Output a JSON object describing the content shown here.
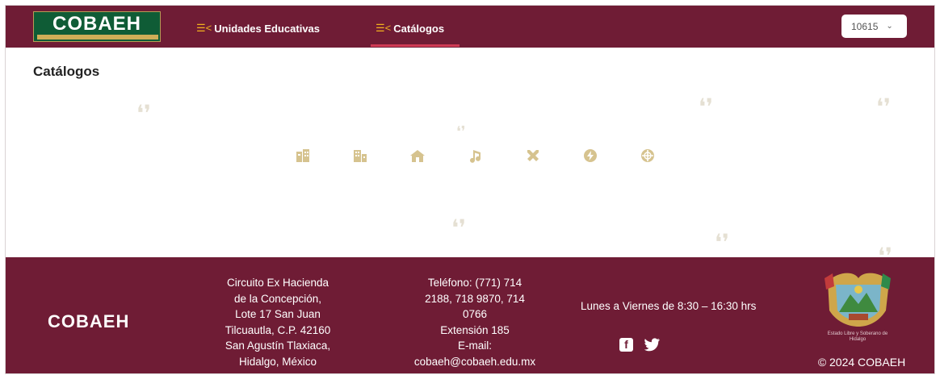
{
  "header": {
    "logo_text": "COBAEH",
    "nav": [
      {
        "label": "Unidades Educativas",
        "icon": "menu-lines-icon"
      },
      {
        "label": "Catálogos",
        "icon": "menu-lines-icon"
      }
    ],
    "selector_value": "10615"
  },
  "page": {
    "title": "Catálogos"
  },
  "catalog_icons": [
    {
      "name": "building-icon"
    },
    {
      "name": "buildings-icon"
    },
    {
      "name": "house-icon"
    },
    {
      "name": "music-icon"
    },
    {
      "name": "tools-icon"
    },
    {
      "name": "bolt-icon"
    },
    {
      "name": "globe-icon"
    }
  ],
  "footer": {
    "logo_text": "COBAEH",
    "address": [
      "Circuito Ex Hacienda",
      "de la Concepción,",
      "Lote 17 San Juan",
      "Tilcuautla, C.P. 42160",
      "San Agustín Tlaxiaca,",
      "Hidalgo, México"
    ],
    "contact": [
      "Teléfono: (771) 714",
      "2188, 718 9870, 714",
      "0766",
      "Extensión 185",
      "E-mail:",
      "cobaeh@cobaeh.edu.mx"
    ],
    "hours": "Lunes a Viernes de 8:30 – 16:30 hrs",
    "copyright": "© 2024 COBAEH",
    "seal_caption": "Estado Libre y Soberano de Hidalgo"
  },
  "colors": {
    "brand": "#6f1c35",
    "accent": "#f2b01e",
    "icon": "#d6c38f"
  }
}
